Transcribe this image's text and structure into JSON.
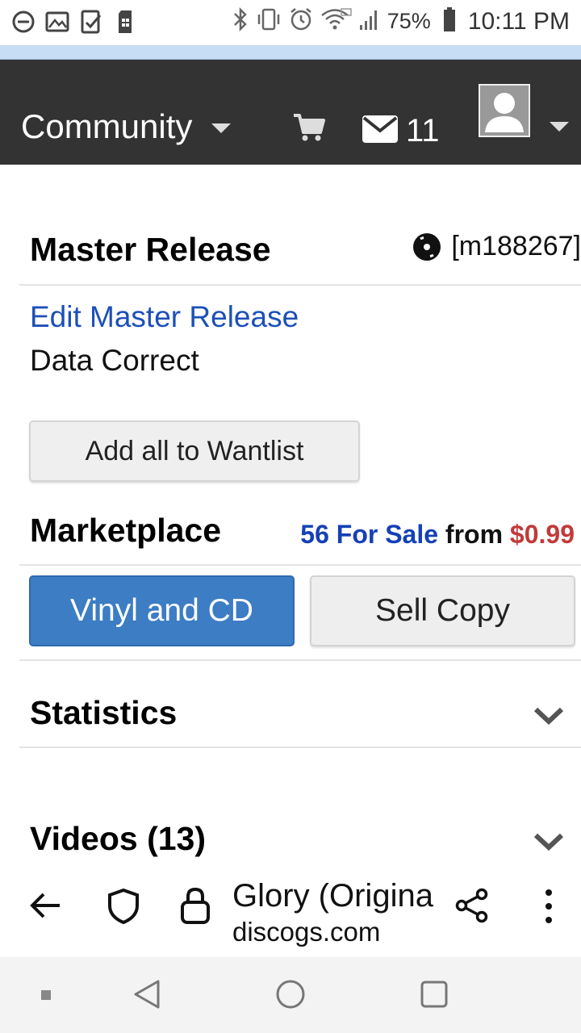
{
  "status_bar": {
    "battery": "75%",
    "time": "10:11 PM",
    "left_icons": [
      "do-not-disturb-icon",
      "image-icon",
      "clipboard-check-icon",
      "sd-card-icon"
    ],
    "right_icons": [
      "bluetooth-icon",
      "vibrate-icon",
      "alarm-icon",
      "wifi-icon",
      "signal-icon",
      "battery-icon"
    ]
  },
  "header": {
    "menu_label": "Community",
    "message_count": "11"
  },
  "master": {
    "heading": "Master Release",
    "id": "[m188267]",
    "edit_link": "Edit Master Release",
    "data_status": "Data Correct",
    "wantlist_button": "Add all to Wantlist"
  },
  "marketplace": {
    "heading": "Marketplace",
    "for_sale": "56 For Sale",
    "from": "from",
    "price": "$0.99",
    "vinyl_button": "Vinyl and CD",
    "sell_button": "Sell Copy"
  },
  "sections": {
    "statistics": "Statistics",
    "videos": "Videos (13)"
  },
  "browser": {
    "page_title": "Glory (Original",
    "domain": "discogs.com"
  },
  "colors": {
    "header_bg": "#333333",
    "link_blue": "#1d4fb8",
    "primary_button": "#3c7dc4",
    "price_red": "#c23a3a"
  }
}
